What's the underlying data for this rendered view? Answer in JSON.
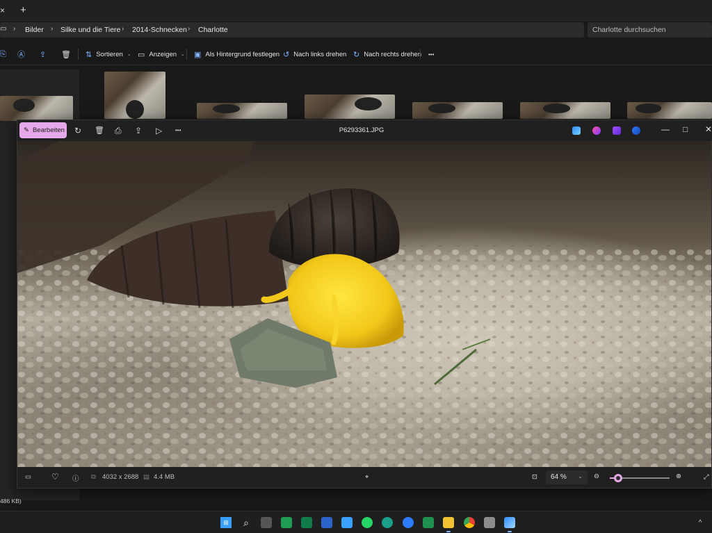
{
  "explorer": {
    "tabbar": {
      "close": "×",
      "new": "+"
    },
    "breadcrumb": [
      "Bilder",
      "Silke und die Tiere",
      "2014-Schnecken",
      "Charlotte"
    ],
    "search_placeholder": "Charlotte durchsuchen",
    "toolbar": {
      "sort_label": "Sortieren",
      "view_label": "Anzeigen",
      "set_background_label": "Als Hintergrund festlegen",
      "rotate_left_label": "Nach links drehen",
      "rotate_right_label": "Nach rechts drehen",
      "more_label": "•••"
    },
    "status_fragment": "486 KB)"
  },
  "viewer": {
    "edit_label": "Bearbeiten",
    "filename": "P6293361.JPG",
    "dimensions": "4032 x 2688",
    "filesize": "4.4 MB",
    "zoom_label": "64 %",
    "zoom_fraction": 0.14,
    "more_label": "•••"
  },
  "icons": {
    "rotate": "↻",
    "delete": "🗑",
    "print": "⎙",
    "share": "⇪",
    "slideshow": "▷",
    "minimize": "—",
    "maximize": "□",
    "close": "✕",
    "filmstrip": "▭",
    "favorite": "♡",
    "info": "ⓘ",
    "crop": "⌖",
    "fit": "⊡",
    "zoom_out": "⊖",
    "zoom_in": "⊕",
    "fullscreen": "⤢",
    "search": "⌕",
    "chevron_up": "^"
  },
  "colors": {
    "accent": "#e5a8e8",
    "link_blue": "#7fb2ff"
  }
}
